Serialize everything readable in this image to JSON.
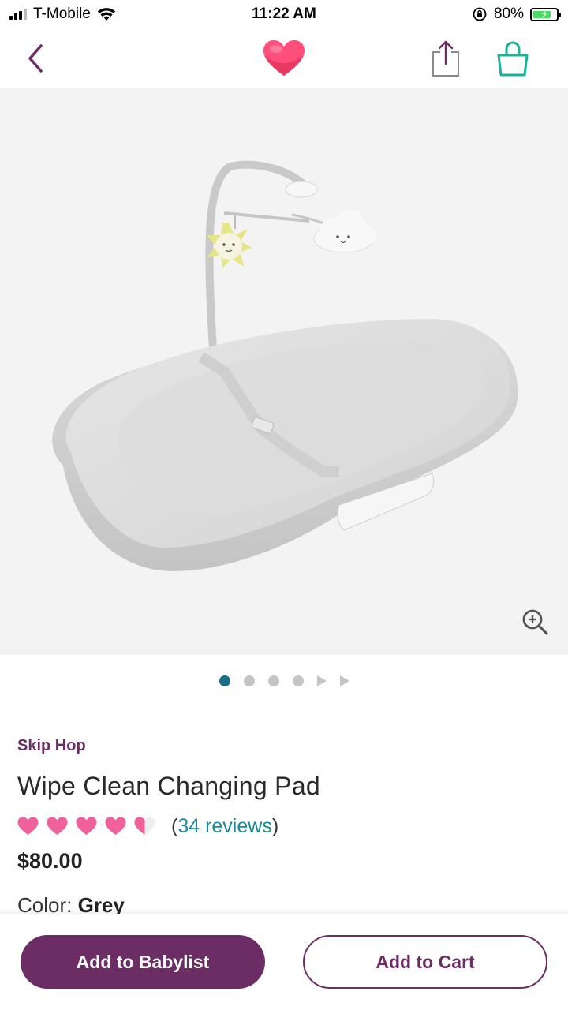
{
  "status_bar": {
    "carrier": "T-Mobile",
    "time": "11:22 AM",
    "battery_percent": "80%",
    "battery_level": 0.8
  },
  "nav": {
    "back_icon": "chevron-left-icon",
    "logo_icon": "heart-logo-icon",
    "share_icon": "share-icon",
    "cart_icon": "shopping-bag-icon"
  },
  "product": {
    "image_count": 6,
    "active_image_index": 0,
    "brand": "Skip Hop",
    "title": "Wipe Clean Changing Pad",
    "rating": 4.5,
    "rating_max": 5,
    "reviews_open": "(",
    "reviews_link": "34 reviews",
    "reviews_close": ")",
    "price": "$80.00",
    "color_label": "Color:",
    "color_value": "Grey"
  },
  "actions": {
    "primary_label": "Add to Babylist",
    "secondary_label": "Add to Cart"
  },
  "colors": {
    "brand_purple": "#6b2d64",
    "link_teal": "#1a8a9a",
    "heart_pink": "#f0609a",
    "cart_teal": "#19b39a",
    "dot_active": "#1a6d86"
  }
}
